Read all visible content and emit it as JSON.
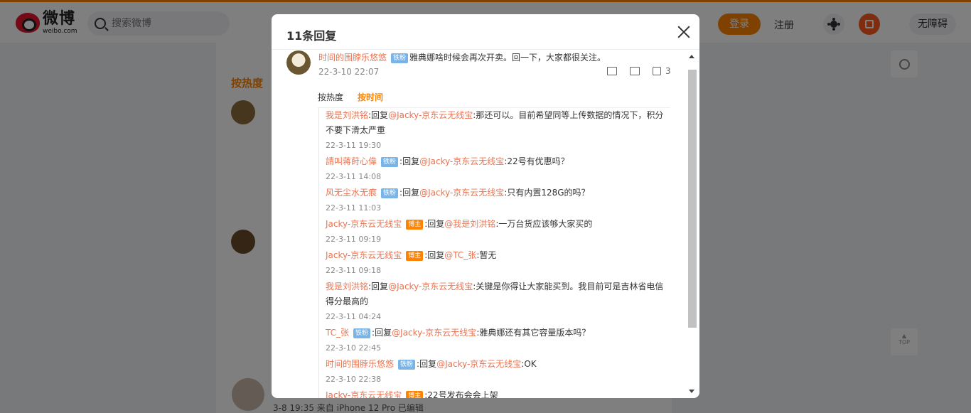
{
  "header": {
    "logo_cn": "微博",
    "logo_en": "weibo.com",
    "search_placeholder": "搜索微博",
    "login_label": "登录",
    "register_label": "注册",
    "accessibility_label": "无障碍"
  },
  "background": {
    "hot_label": "按热度",
    "post_meta": "3-8 19:35 来自 iPhone 12 Pro 已编辑"
  },
  "modal": {
    "title": "11条回复",
    "root": {
      "user": "时间的围脖乐悠悠",
      "badge": "铁粉",
      "text": "雅典娜啥时候会再次开卖。回一下，大家都很关注。",
      "time": "22-3-10 22:07",
      "like_count": "3"
    },
    "tabs": [
      "按热度",
      "按时间"
    ],
    "active_tab": "按时间",
    "replies": [
      {
        "user": "我是刘洪铭",
        "badge": "",
        "text": ":回复@Jacky-京东云无线宝:那还可以。目前希望同等上传数据的情况下，积分不要下滑太严重",
        "mention": "@Jacky-京东云无线宝",
        "time": "22-3-11 19:30"
      },
      {
        "user": "請叫蒋莳心偉",
        "badge": "铁粉",
        "text": ":回复@Jacky-京东云无线宝:22号有优惠吗？",
        "time": "22-3-11 14:08"
      },
      {
        "user": "风无尘水无痕",
        "badge": "铁粉",
        "text": ":回复@Jacky-京东云无线宝:只有内置128G的吗？",
        "time": "22-3-11 11:03"
      },
      {
        "user": "Jacky-京东云无线宝",
        "badge": "博主",
        "text": ":回复@我是刘洪铭:一万台货应该够大家买的",
        "time": "22-3-11 09:19"
      },
      {
        "user": "Jacky-京东云无线宝",
        "badge": "博主",
        "text": ":回复@TC_张:暂无",
        "time": "22-3-11 09:18"
      },
      {
        "user": "我是刘洪铭",
        "badge": "",
        "text": ":回复@Jacky-京东云无线宝:关键是你得让大家能买到。我目前可是吉林省电信得分最高的",
        "time": "22-3-11 04:24"
      },
      {
        "user": "TC_张",
        "badge": "铁粉",
        "text": ":回复@Jacky-京东云无线宝:雅典娜还有其它容量版本吗？",
        "time": "22-3-10 22:45"
      },
      {
        "user": "时间的围脖乐悠悠",
        "badge": "铁粉",
        "text": ":回复@Jacky-京东云无线宝:OK",
        "time": "22-3-10 22:38"
      },
      {
        "user": "Jacky-京东云无线宝",
        "badge": "博主",
        "text": ":22号发布会会上架",
        "time": ""
      }
    ]
  }
}
